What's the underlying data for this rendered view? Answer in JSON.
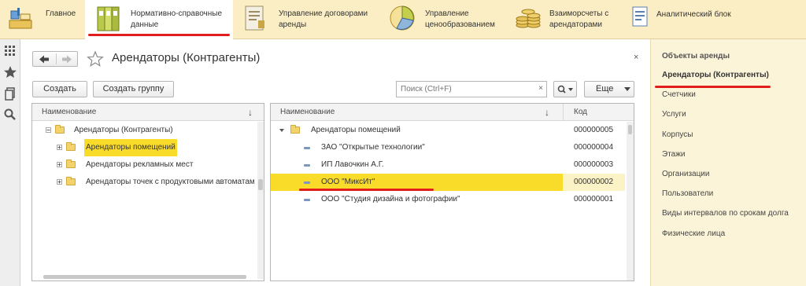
{
  "sections": [
    {
      "label": "Главное",
      "icon": "home-icon"
    },
    {
      "label": "Нормативно-справочные\nданные",
      "icon": "binders-icon",
      "active": true
    },
    {
      "label": "Управление договорами\nаренды",
      "icon": "contract-icon"
    },
    {
      "label": "Управление\nценообразованием",
      "icon": "pricing-icon"
    },
    {
      "label": "Взаиморсчеты с\nарендаторами",
      "icon": "coins-icon"
    },
    {
      "label": "Аналитический блок",
      "icon": "report-icon"
    }
  ],
  "left_panel": [
    "apps-grid-icon",
    "star-icon",
    "history-icon",
    "search-icon"
  ],
  "form": {
    "title": "Арендаторы (Контрагенты)",
    "close": "×",
    "create_label": "Создать",
    "create_group_label": "Создать группу",
    "search_placeholder": "Поиск (Ctrl+F)",
    "search_clear": "×",
    "more_label": "Еще"
  },
  "tree": {
    "header": "Наименование",
    "sort_arrow": "↓",
    "rows": [
      {
        "label": "Арендаторы (Контрагенты)"
      },
      {
        "label": "Арендаторы помещений"
      },
      {
        "label": "Арендаторы рекламных мест"
      },
      {
        "label": "Арендаторы точек с продуктовыми автоматами"
      }
    ]
  },
  "list": {
    "header_name": "Наименование",
    "sort_arrow": "↓",
    "header_code": "Код",
    "rows": [
      {
        "name": "Арендаторы помещений",
        "code": "000000005"
      },
      {
        "name": "ЗАО \"Открытые технологии\"",
        "code": "000000004"
      },
      {
        "name": "ИП Лавочкин А.Г.",
        "code": "000000003"
      },
      {
        "name": "ООО \"МиксИт\"",
        "code": "000000002"
      },
      {
        "name": "ООО \"Студия дизайна и фотографии\"",
        "code": "000000001"
      }
    ]
  },
  "right_panel": {
    "heading": "Объекты аренды",
    "items": [
      "Арендаторы (Контрагенты)",
      "Счетчики",
      "Услуги",
      "Корпусы",
      "Этажи",
      "Организации",
      "Пользователи",
      "Виды интервалов по срокам долга",
      "Физические лица"
    ]
  },
  "colors": {
    "accent_bar": "#fbeec4",
    "selection": "#f9dc2a",
    "annotation": "#e11d1d"
  }
}
